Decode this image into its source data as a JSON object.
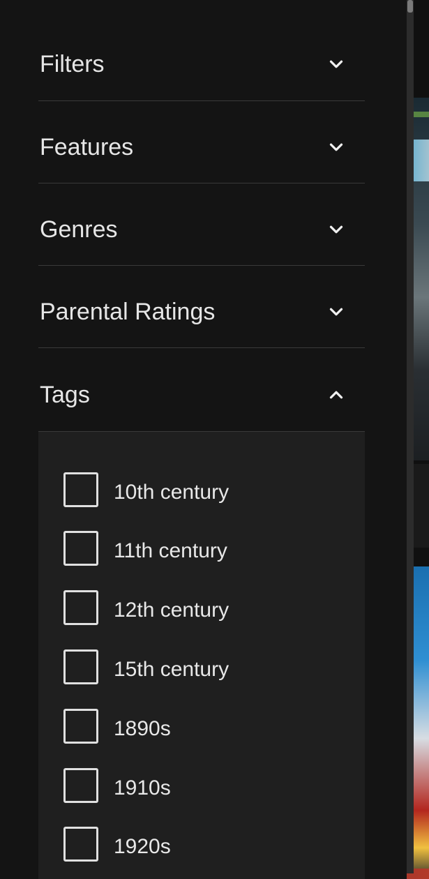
{
  "sections": [
    {
      "label": "Filters",
      "expanded": false,
      "icon": "chevron-down-icon"
    },
    {
      "label": "Features",
      "expanded": false,
      "icon": "chevron-down-icon"
    },
    {
      "label": "Genres",
      "expanded": false,
      "icon": "chevron-down-icon"
    },
    {
      "label": "Parental Ratings",
      "expanded": false,
      "icon": "chevron-down-icon"
    },
    {
      "label": "Tags",
      "expanded": true,
      "icon": "chevron-up-icon"
    }
  ],
  "tags": {
    "items": [
      {
        "label": "10th century",
        "checked": false
      },
      {
        "label": "11th century",
        "checked": false
      },
      {
        "label": "12th century",
        "checked": false
      },
      {
        "label": "15th century",
        "checked": false
      },
      {
        "label": "1890s",
        "checked": false
      },
      {
        "label": "1910s",
        "checked": false
      },
      {
        "label": "1920s",
        "checked": false
      }
    ]
  },
  "colors": {
    "panel_bg": "#141414",
    "tags_body_bg": "#1f1f1f",
    "text": "#e6e6e6",
    "divider": "#3a3a3a"
  }
}
